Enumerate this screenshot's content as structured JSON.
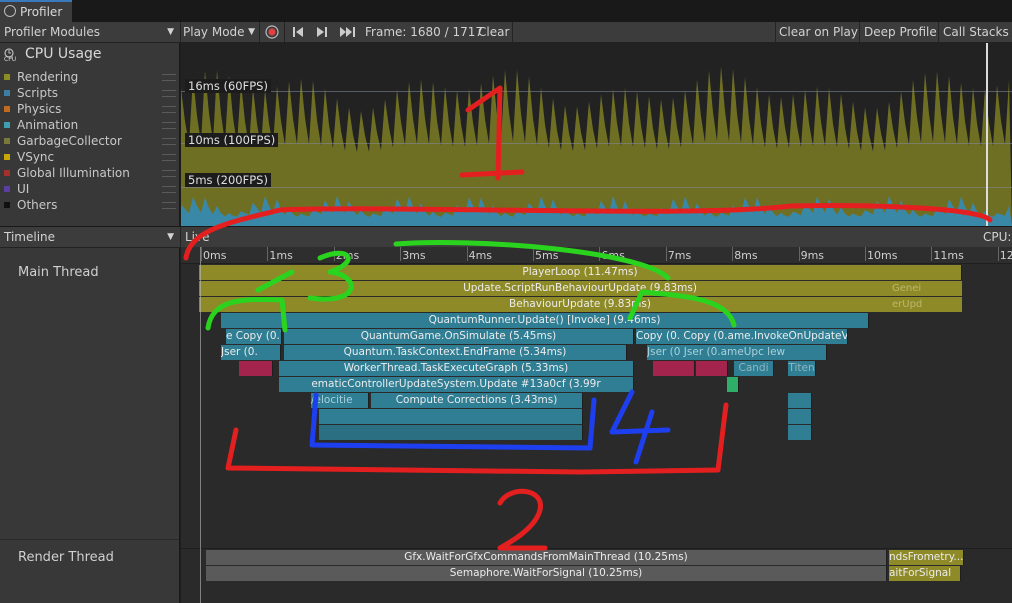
{
  "window": {
    "tab_title": "Profiler"
  },
  "toolbar": {
    "modules_label": "Profiler Modules",
    "play_mode_label": "Play Mode",
    "frame_label": "Frame: 1680 / 1717",
    "clear_label": "Clear",
    "clear_on_play_label": "Clear on Play",
    "deep_profile_label": "Deep Profile",
    "call_stacks_label": "Call Stacks"
  },
  "cpu_module": {
    "title": "CPU Usage",
    "icon_text": "CPU",
    "legend": [
      {
        "label": "Rendering",
        "color": "#8c8c24"
      },
      {
        "label": "Scripts",
        "color": "#3d7fa3"
      },
      {
        "label": "Physics",
        "color": "#c46a1c"
      },
      {
        "label": "Animation",
        "color": "#3ca0b0"
      },
      {
        "label": "GarbageCollector",
        "color": "#7a7a3a"
      },
      {
        "label": "VSync",
        "color": "#c8a800"
      },
      {
        "label": "Global Illumination",
        "color": "#a4302c"
      },
      {
        "label": "UI",
        "color": "#5a3fa0"
      },
      {
        "label": "Others",
        "color": "#101010"
      }
    ],
    "ref_labels": [
      "16ms (60FPS)",
      "10ms (100FPS)",
      "5ms (200FPS)"
    ],
    "cpu_readout": "CPU:"
  },
  "timeline": {
    "view_label": "Timeline",
    "live_label": "Live",
    "ticks": [
      "0ms",
      "1ms",
      "2ms",
      "3ms",
      "4ms",
      "5ms",
      "6ms",
      "7ms",
      "8ms",
      "9ms",
      "10ms",
      "11ms",
      "12r"
    ],
    "main_thread_label": "Main Thread",
    "render_thread_label": "Render Thread",
    "main_bars": [
      "PlayerLoop (11.47ms)",
      "Update.ScriptRunBehaviourUpdate (9.83ms)",
      "BehaviourUpdate (9.83ms)",
      "QuantumRunner.Update() [Invoke] (9.46ms)",
      "QuantumGame.OnSimulate (5.45ms)",
      "Quantum.TaskContext.EndFrame (5.34ms)",
      "WorkerThread.TaskExecuteGraph (5.33ms)",
      "ematicControllerUpdateSystem.Update #13a0cf (3.99r",
      "Compute Corrections (3.43ms)"
    ],
    "side_bars": {
      "copy_left": "e Copy (0.7",
      "copy_right": "Copy (0. Copy (0.ame.InvokeOnUpdateVie",
      "user_left": "Jser (0.",
      "user_right": "Jser (0 Jser (0.ameUpc lew",
      "velocity": "/elocitie",
      "gener": "Genei",
      "erupd": "erUpd",
      "candi": "Candi",
      "titem": "Titen"
    },
    "render_bars": [
      "Gfx.WaitForGfxCommandsFromMainThread (10.25ms)",
      "Semaphore.WaitForSignal (10.25ms)"
    ],
    "render_side": [
      "ndsFrometry...",
      "aitForSignal"
    ]
  },
  "annotations": [
    "1",
    "2",
    "3",
    "4"
  ]
}
